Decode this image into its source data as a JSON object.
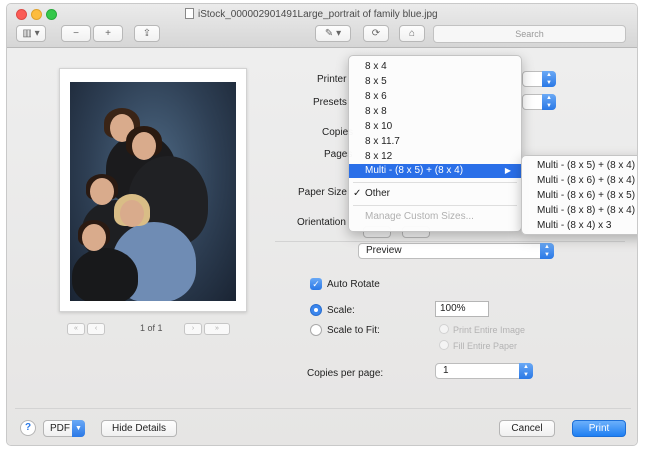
{
  "window": {
    "title": "iStock_000002901491Large_portrait of family blue.jpg"
  },
  "toolbar": {
    "sidebar_glyph": "▥ ▾",
    "zoom_out_glyph": "−",
    "zoom_in_glyph": "+",
    "share_glyph": "⇪",
    "markup_glyph": "✎ ▾",
    "rotate_glyph": "⟳",
    "toolbox_glyph": "⌂",
    "search_placeholder": "Search"
  },
  "preview_pane": {
    "page_indicator": "1 of 1",
    "first_glyph": "«",
    "prev_glyph": "‹",
    "next_glyph": "›",
    "last_glyph": "»"
  },
  "settings": {
    "printer_label": "Printer",
    "presets_label": "Presets",
    "copies_label": "Copies",
    "pages_label": "Pages",
    "paper_size_label": "Paper Size",
    "orientation_label": "Orientation",
    "app_section_value": "Preview",
    "auto_rotate_label": "Auto Rotate",
    "scale_label": "Scale:",
    "scale_value": "100%",
    "scale_to_fit_label": "Scale to Fit:",
    "print_entire_image_label": "Print Entire Image",
    "fill_entire_paper_label": "Fill Entire Paper",
    "copies_per_page_label": "Copies per page:",
    "copies_per_page_value": "1"
  },
  "paper_size_menu": {
    "items": [
      "8 x 4",
      "8 x 5",
      "8 x 6",
      "8 x 8",
      "8 x 10",
      "8 x 11.7",
      "8 x 12"
    ],
    "highlighted_item": "Multi - (8 x 5) + (8 x 4)",
    "submenu_arrow": "▶",
    "checked_item": "Other",
    "check_glyph": "✓",
    "manage_item": "Manage Custom Sizes..."
  },
  "multi_submenu": {
    "items": [
      "Multi - (8 x 5) + (8 x 4)",
      "Multi - (8 x 6) + (8 x 4)",
      "Multi - (8 x 6) + (8 x 5)",
      "Multi - (8 x 8) + (8 x 4)",
      "Multi - (8 x 4) x 3"
    ]
  },
  "footer": {
    "help_glyph": "?",
    "pdf_label": "PDF",
    "hide_details_label": "Hide Details",
    "cancel_label": "Cancel",
    "print_label": "Print"
  },
  "colors": {
    "accent": "#2a78e6",
    "menu_highlight": "#2a6fe8",
    "photo_background": "#3a4f66"
  }
}
